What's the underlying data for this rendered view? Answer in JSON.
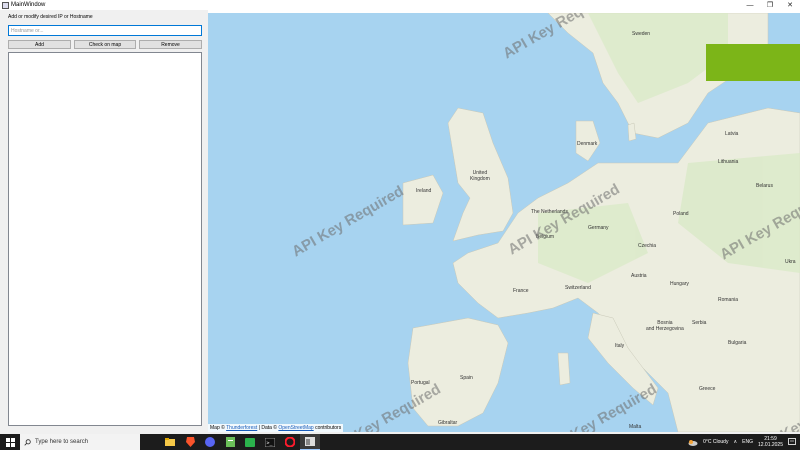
{
  "window": {
    "title": "MainWindow",
    "controls": {
      "minimize": "—",
      "maximize": "❐",
      "close": "✕"
    }
  },
  "form": {
    "prompt_label": "Add or modify desired IP or Hostname",
    "hostname_placeholder": "Hostname or...",
    "hostname_value": "",
    "add_label": "Add",
    "check_label": "Check on map",
    "remove_label": "Remove",
    "host_list": []
  },
  "map": {
    "watermark": "API Key Required",
    "accent_color": "#7cb518",
    "labels": {
      "sweden": "Sweden",
      "latvia": "Latvia",
      "lithuania": "Lithuania",
      "denmark": "Denmark",
      "belarus": "Belarus",
      "ireland": "Ireland",
      "united_kingdom": "United\nKingdom",
      "netherlands": "The Netherlands",
      "poland": "Poland",
      "belgium": "Belgium",
      "germany": "Germany",
      "czechia": "Czechia",
      "ukraine": "Ukra",
      "austria": "Austria",
      "france": "France",
      "switzerland": "Switzerland",
      "hungary": "Hungary",
      "romania": "Romania",
      "bosnia": "Bosnia\nand Herzegovina",
      "serbia": "Serbia",
      "bulgaria": "Bulgaria",
      "italy": "Italy",
      "portugal": "Portugal",
      "spain": "Spain",
      "greece": "Greece",
      "gibraltar": "Gibraltar",
      "malta": "Malta"
    },
    "attribution": {
      "prefix": "Map ©",
      "provider": "Thunderforest",
      "separator": "| Data ©",
      "source": "OpenStreetMap",
      "suffix": "contributors"
    }
  },
  "taskbar": {
    "search_placeholder": "Type here to search",
    "weather": "0°C  Cloudy",
    "language": "ENG",
    "time": "21:59",
    "date": "12.01.2025",
    "apps": [
      "file-explorer-icon",
      "brave-browser-icon",
      "discord-icon",
      "notepad-icon",
      "spreadsheet-icon",
      "terminal-icon",
      "opera-icon",
      "app-window-icon"
    ]
  }
}
